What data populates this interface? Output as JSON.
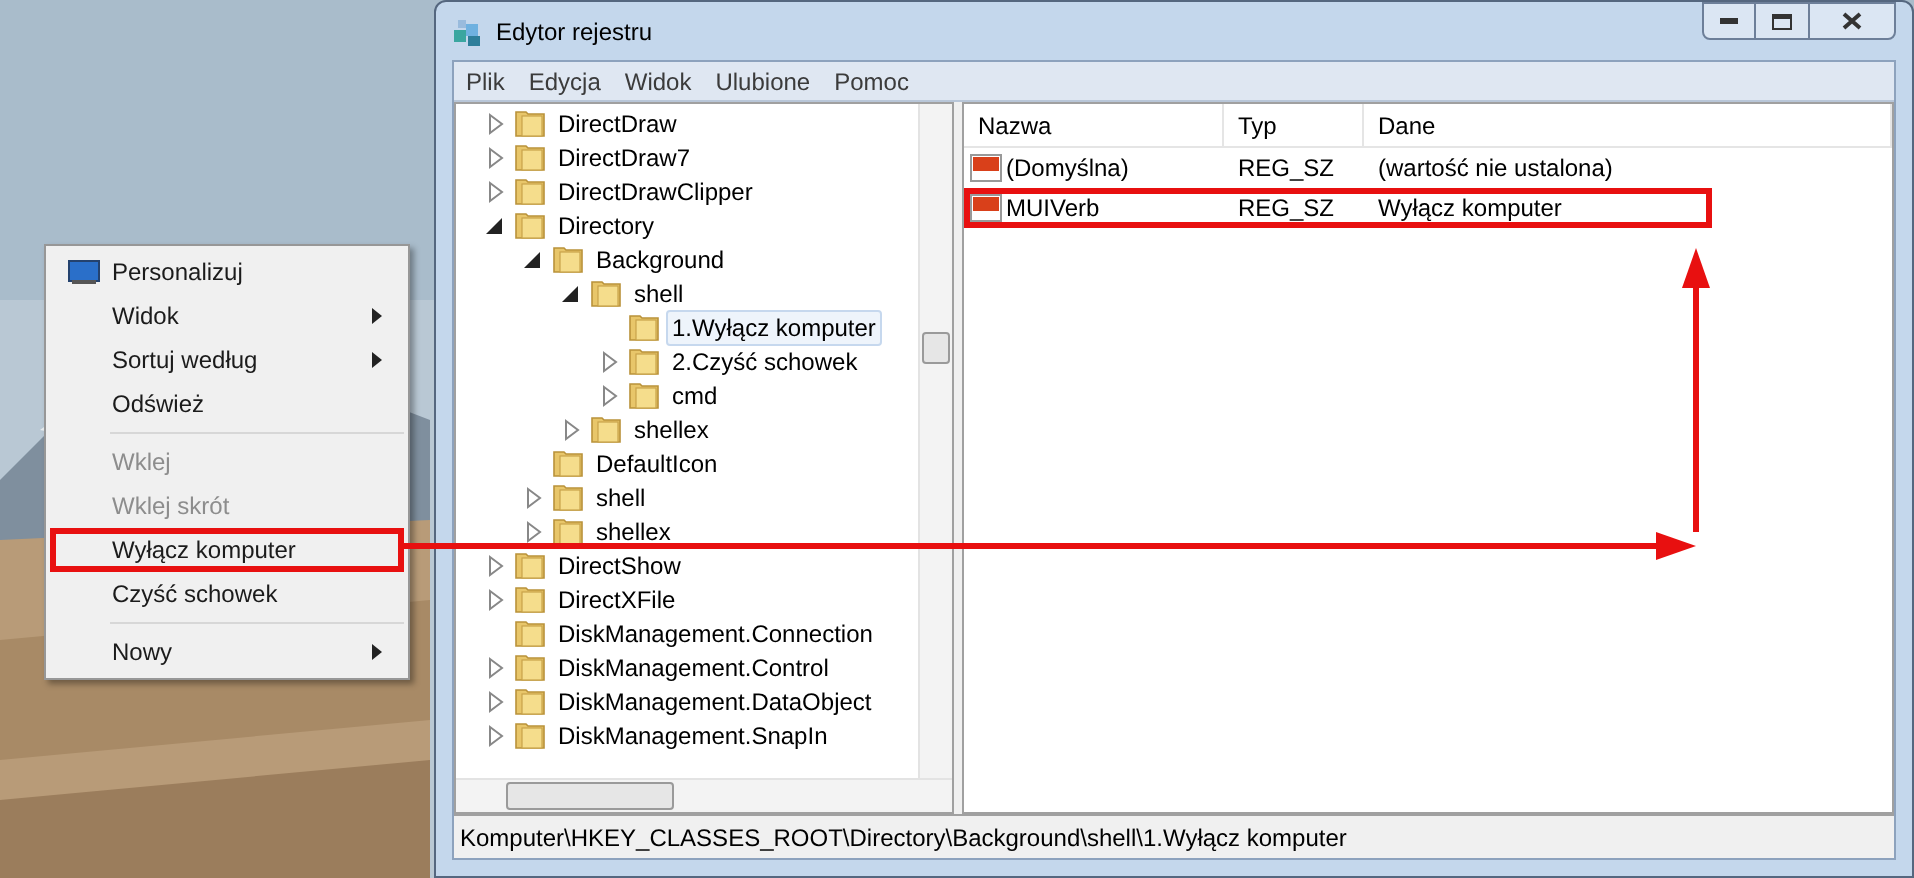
{
  "context_menu": {
    "groups": [
      [
        {
          "label": "Personalizuj",
          "kind": "icon-item",
          "submenu": false,
          "disabled": false,
          "highlighted": false
        },
        {
          "label": "Widok",
          "kind": "item",
          "submenu": true,
          "disabled": false,
          "highlighted": false
        },
        {
          "label": "Sortuj według",
          "kind": "item",
          "submenu": true,
          "disabled": false,
          "highlighted": false
        },
        {
          "label": "Odśwież",
          "kind": "item",
          "submenu": false,
          "disabled": false,
          "highlighted": false
        }
      ],
      [
        {
          "label": "Wklej",
          "kind": "item",
          "submenu": false,
          "disabled": true,
          "highlighted": false
        },
        {
          "label": "Wklej skrót",
          "kind": "item",
          "submenu": false,
          "disabled": true,
          "highlighted": false
        },
        {
          "label": "Wyłącz komputer",
          "kind": "item",
          "submenu": false,
          "disabled": false,
          "highlighted": true
        },
        {
          "label": "Czyść schowek",
          "kind": "item",
          "submenu": false,
          "disabled": false,
          "highlighted": false
        }
      ],
      [
        {
          "label": "Nowy",
          "kind": "item",
          "submenu": true,
          "disabled": false,
          "highlighted": false
        }
      ]
    ]
  },
  "window": {
    "title": "Edytor rejestru",
    "menu": [
      "Plik",
      "Edycja",
      "Widok",
      "Ulubione",
      "Pomoc"
    ],
    "tree": [
      {
        "name": "DirectDraw",
        "kind": "branch",
        "expanded": false,
        "selected": false
      },
      {
        "name": "DirectDraw7",
        "kind": "branch",
        "expanded": false,
        "selected": false
      },
      {
        "name": "DirectDrawClipper",
        "kind": "branch",
        "expanded": false,
        "selected": false
      },
      {
        "name": "Directory",
        "kind": "branch",
        "expanded": true,
        "selected": false,
        "children": [
          {
            "name": "Background",
            "kind": "branch",
            "expanded": true,
            "selected": false,
            "children": [
              {
                "name": "shell",
                "kind": "branch",
                "expanded": true,
                "selected": false,
                "children": [
                  {
                    "name": "1.Wyłącz komputer",
                    "kind": "leaf",
                    "selected": true
                  },
                  {
                    "name": "2.Czyść schowek",
                    "kind": "branch",
                    "expanded": false,
                    "selected": false
                  },
                  {
                    "name": "cmd",
                    "kind": "branch",
                    "expanded": false,
                    "selected": false
                  }
                ]
              },
              {
                "name": "shellex",
                "kind": "branch",
                "expanded": false,
                "selected": false
              }
            ]
          },
          {
            "name": "DefaultIcon",
            "kind": "leaf",
            "selected": false
          },
          {
            "name": "shell",
            "kind": "branch",
            "expanded": false,
            "selected": false
          },
          {
            "name": "shellex",
            "kind": "branch",
            "expanded": false,
            "selected": false
          }
        ]
      },
      {
        "name": "DirectShow",
        "kind": "branch",
        "expanded": false,
        "selected": false
      },
      {
        "name": "DirectXFile",
        "kind": "branch",
        "expanded": false,
        "selected": false
      },
      {
        "name": "DiskManagement.Connection",
        "kind": "leaf",
        "selected": false
      },
      {
        "name": "DiskManagement.Control",
        "kind": "branch",
        "expanded": false,
        "selected": false
      },
      {
        "name": "DiskManagement.DataObject",
        "kind": "branch",
        "expanded": false,
        "selected": false
      },
      {
        "name": "DiskManagement.SnapIn",
        "kind": "branch",
        "expanded": false,
        "selected": false
      }
    ],
    "columns": [
      "Nazwa",
      "Typ",
      "Dane"
    ],
    "values": [
      {
        "name": "(Domyślna)",
        "type": "REG_SZ",
        "data": "(wartość nie ustalona)",
        "highlighted": false
      },
      {
        "name": "MUIVerb",
        "type": "REG_SZ",
        "data": "Wyłącz komputer",
        "highlighted": true
      }
    ],
    "status_bar": "Komputer\\HKEY_CLASSES_ROOT\\Directory\\Background\\shell\\1.Wyłącz komputer"
  }
}
